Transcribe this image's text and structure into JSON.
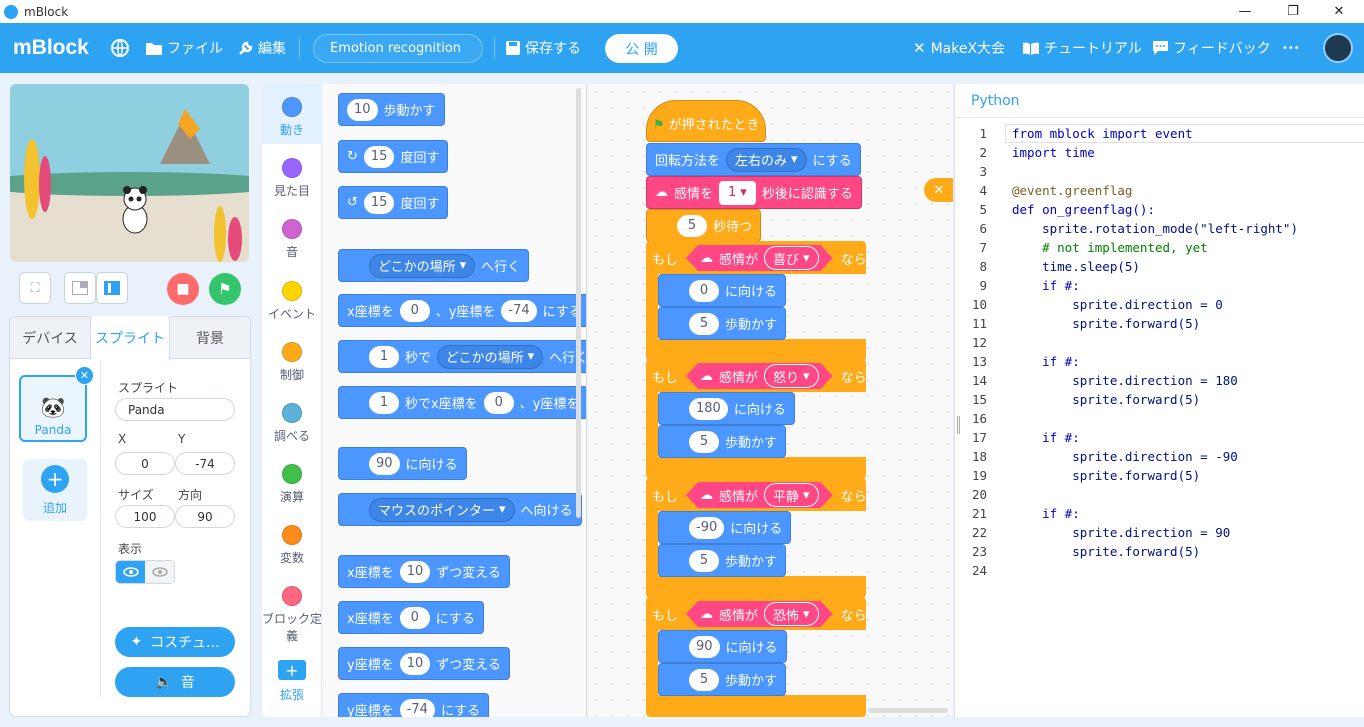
{
  "window": {
    "title": "mBlock",
    "min": "—",
    "max": "❐",
    "close": "✕"
  },
  "menubar": {
    "logo": "mBlock",
    "file": "ファイル",
    "edit": "編集",
    "project_name": "Emotion recognition",
    "save": "保存する",
    "publish": "公 開",
    "makex": "MakeX大会",
    "tutorial": "チュートリアル",
    "feedback": "フィードバック",
    "more": "•••"
  },
  "stage_controls": {
    "fullscreen": "⛶",
    "stop": "■",
    "go": "⚑"
  },
  "tabs": {
    "device": "デバイス",
    "sprite": "スプライト",
    "backdrop": "背景"
  },
  "sprite": {
    "thumb_name": "Panda",
    "add_label": "追加",
    "sprite_label": "スプライト",
    "name": "Panda",
    "x_label": "X",
    "y_label": "Y",
    "x": "0",
    "y": "-74",
    "size_label": "サイズ",
    "dir_label": "方向",
    "size": "100",
    "direction": "90",
    "show_label": "表示",
    "costume_btn": "コスチュ...",
    "sound_btn": "音"
  },
  "categories": [
    {
      "label": "動き",
      "color": "#4c97ff"
    },
    {
      "label": "見た目",
      "color": "#9966ff"
    },
    {
      "label": "音",
      "color": "#cf63cf"
    },
    {
      "label": "イベント",
      "color": "#ffd500"
    },
    {
      "label": "制御",
      "color": "#ffab19"
    },
    {
      "label": "調べる",
      "color": "#5cb1d6"
    },
    {
      "label": "演算",
      "color": "#40bf4a"
    },
    {
      "label": "変数",
      "color": "#ff8c1a"
    },
    {
      "label": "ブロック定義",
      "color": "#ff6680"
    }
  ],
  "extension": {
    "label": "拡張",
    "icon": "+"
  },
  "palette": {
    "move_val": "10",
    "move_txt": "歩動かす",
    "turn_r_val": "15",
    "turn_txt": "度回す",
    "turn_l_val": "15",
    "goto_dd": "どこかの場所",
    "goto_txt": "へ行く",
    "gotoxy_a": "x座標を",
    "gotoxy_x": "0",
    "gotoxy_b": "、y座標を",
    "gotoxy_y": "-74",
    "gotoxy_c": "にする",
    "glide_val": "1",
    "glide_a": "秒で",
    "glide_dd": "どこかの場所",
    "glide_b": "へ行く",
    "glidexy_val": "1",
    "glidexy_a": "秒でx座標を",
    "glidexy_x": "0",
    "glidexy_b": "、y座標を",
    "point_val": "90",
    "point_txt": "に向ける",
    "pointto_dd": "マウスのポインター",
    "pointto_txt": "へ向ける",
    "changex_a": "x座標を",
    "changex_val": "10",
    "changex_b": "ずつ変える",
    "setx_a": "x座標を",
    "setx_val": "0",
    "setx_b": "にする",
    "changey_a": "y座標を",
    "changey_val": "10",
    "changey_b": "ずつ変える",
    "sety_a": "y座標を",
    "sety_val": "-74",
    "sety_b": "にする"
  },
  "script": {
    "hat": "が押されたとき",
    "rot_a": "回転方法を",
    "rot_dd": "左右のみ",
    "rot_b": "にする",
    "emo_a": "感情を",
    "emo_val": "1",
    "emo_b": "秒後に認識する",
    "wait_val": "5",
    "wait_txt": "秒待つ",
    "if_txt": "もし",
    "then_txt": "なら",
    "emo_is": "感情が",
    "ifs": [
      {
        "emotion": "喜び",
        "dir": "0",
        "steps": "5"
      },
      {
        "emotion": "怒り",
        "dir": "180",
        "steps": "5"
      },
      {
        "emotion": "平静",
        "dir": "-90",
        "steps": "5"
      },
      {
        "emotion": "恐怖",
        "dir": "90",
        "steps": "5"
      }
    ],
    "dir_txt": "に向ける",
    "steps_txt": "歩動かす"
  },
  "code": {
    "title": "Python",
    "lines": [
      {
        "n": "1",
        "t": "from mblock import event"
      },
      {
        "n": "2",
        "t": "import time"
      },
      {
        "n": "3",
        "t": ""
      },
      {
        "n": "4",
        "t": "@event.greenflag"
      },
      {
        "n": "5",
        "t": "def on_greenflag():"
      },
      {
        "n": "6",
        "t": "    sprite.rotation_mode(\"left-right\")"
      },
      {
        "n": "7",
        "t": "    # not implemented, yet"
      },
      {
        "n": "8",
        "t": "    time.sleep(5)"
      },
      {
        "n": "9",
        "t": "    if #:"
      },
      {
        "n": "10",
        "t": "        sprite.direction = 0"
      },
      {
        "n": "11",
        "t": "        sprite.forward(5)"
      },
      {
        "n": "12",
        "t": ""
      },
      {
        "n": "13",
        "t": "    if #:"
      },
      {
        "n": "14",
        "t": "        sprite.direction = 180"
      },
      {
        "n": "15",
        "t": "        sprite.forward(5)"
      },
      {
        "n": "16",
        "t": ""
      },
      {
        "n": "17",
        "t": "    if #:"
      },
      {
        "n": "18",
        "t": "        sprite.direction = -90"
      },
      {
        "n": "19",
        "t": "        sprite.forward(5)"
      },
      {
        "n": "20",
        "t": ""
      },
      {
        "n": "21",
        "t": "    if #:"
      },
      {
        "n": "22",
        "t": "        sprite.direction = 90"
      },
      {
        "n": "23",
        "t": "        sprite.forward(5)"
      },
      {
        "n": "24",
        "t": ""
      }
    ]
  }
}
